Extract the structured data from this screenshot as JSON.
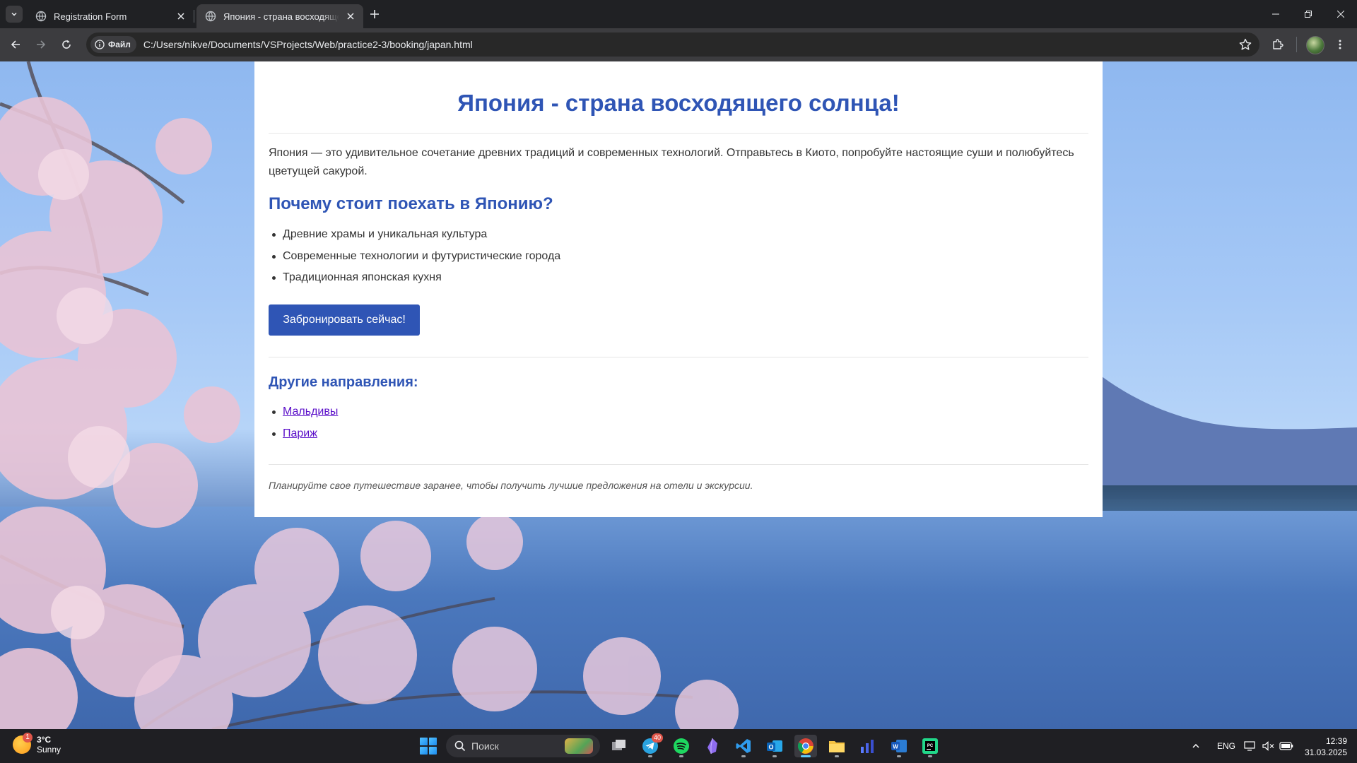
{
  "browser": {
    "tabs": [
      {
        "title": "Registration Form",
        "active": false
      },
      {
        "title": "Япония - страна восходящего солнца!",
        "active": true
      }
    ],
    "security_chip": "Файл",
    "url": "C:/Users/nikve/Documents/VSProjects/Web/practice2-3/booking/japan.html"
  },
  "page": {
    "title": "Япония - страна восходящего солнца!",
    "intro": "Япония — это удивительное сочетание древних традиций и современных технологий. Отправьтесь в Киото, попробуйте настоящие суши и полюбуйтесь цветущей сакурой.",
    "why_heading": "Почему стоит поехать в Японию?",
    "reasons": [
      "Древние храмы и уникальная культура",
      "Современные технологии и футуристические города",
      "Традиционная японская кухня"
    ],
    "book_button": "Забронировать сейчас!",
    "other_heading": "Другие направления:",
    "destinations": [
      "Мальдивы",
      "Париж"
    ],
    "footer_note": "Планируйте свое путешествие заранее, чтобы получить лучшие предложения на отели и экскурсии."
  },
  "taskbar": {
    "weather": {
      "temp": "3°C",
      "condition": "Sunny",
      "badge": "1"
    },
    "search_placeholder": "Поиск",
    "telegram_badge": "40",
    "language": "ENG",
    "time": "12:39",
    "date": "31.03.2025"
  },
  "colors": {
    "accent": "#2f55b5",
    "link": "#5b0fc9",
    "chrome_dark": "#202124",
    "toolbar": "#3c3c3f"
  }
}
